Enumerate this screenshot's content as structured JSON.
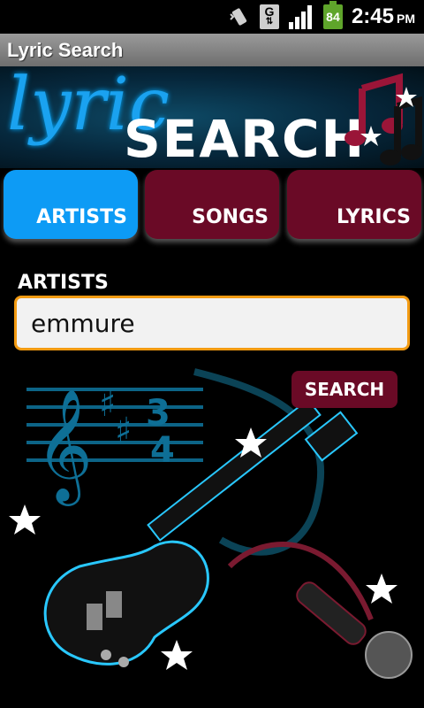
{
  "status_bar": {
    "battery_level": "84",
    "network_letter": "G",
    "time": "2:45",
    "ampm": "PM"
  },
  "title_bar": {
    "title": "Lyric Search"
  },
  "banner": {
    "word1": "lyric",
    "word2": "SEARCH"
  },
  "tabs": [
    {
      "label": "ARTISTS",
      "active": true
    },
    {
      "label": "SONGS",
      "active": false
    },
    {
      "label": "LYRICS",
      "active": false
    }
  ],
  "search_form": {
    "label": "ARTISTS",
    "value": "emmure",
    "button_label": "SEARCH"
  },
  "colors": {
    "active_tab": "#0d9bf5",
    "inactive_tab": "#6a0a26",
    "input_border": "#f39b12",
    "glow": "#29c8ff"
  }
}
